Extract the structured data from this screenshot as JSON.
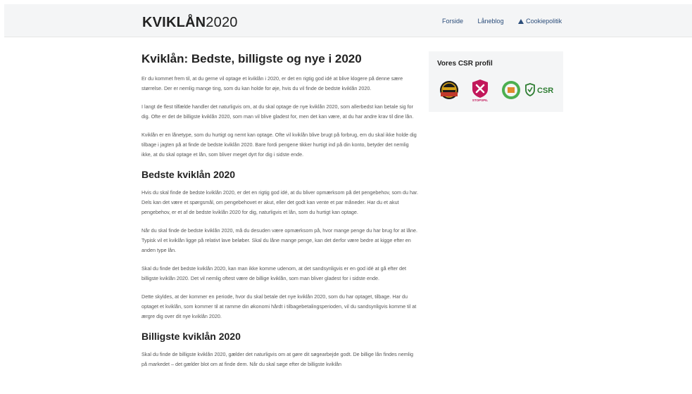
{
  "header": {
    "logo_bold": "KVIKLÅN",
    "logo_year": "2020",
    "nav": [
      {
        "label": "Forside"
      },
      {
        "label": "Låneblog"
      },
      {
        "label": "Cookiepolitik",
        "icon": "warning-icon"
      }
    ]
  },
  "main": {
    "title": "Kviklån: Bedste, billigste og nye i 2020",
    "intro": [
      "Er du kommet frem til, at du gerne vil optage et kviklån i 2020, er det en rigtig god idé at blive klogere på denne sære størrelse. Der er nemlig mange ting, som du kan holde for øje, hvis du vil finde de bedste kviklån 2020.",
      "I langt de flest tilfælde handler det naturligvis om, at du skal optage de nye kviklån 2020, som allerbedst kan betale sig for dig. Ofte er det de billigste kviklån 2020, som man vil blive gladest for, men det kan være, at du har andre krav til dine lån.",
      "Kviklån er en lånetype, som du hurtigt og nemt kan optage. Ofte vil kviklån blive brugt på forbrug, em du skal ikke holde dig tilbage i jagten på at finde de bedste kviklån 2020. Bare fordi pengene tikker hurtigt ind på din konto, betyder det nemlig ikke, at du skal optage et lån, som bliver meget dyrt for dig i sidste ende."
    ],
    "section1": {
      "heading": "Bedste kviklån 2020",
      "paragraphs": [
        "Hvis du skal finde de bedste kviklån 2020, er det en rigtig god idé, at du bliver opmærksom på det pengebehov, som du har. Dels kan det være et spørgsmål, om pengebehovet er akut, eller det godt kan vente et par måneder. Har du et akut pengebehov, er et af de bedste kviklån 2020 for dig, naturligvis et lån, som du hurtigt kan optage.",
        "Når du skal finde de bedste kviklån 2020, må du desuden være opmærksom på, hvor mange penge du har brug for at låne. Typisk vil et kviklån ligge på relativt lave beløber. Skal du låne mange penge, kan det derfor være bedre at kigge efter en anden type lån.",
        "Skal du finde det bedste kviklån 2020, kan man ikke komme udenom, at det sandsynligvis er en god idé at gå efter det billigste kviklån 2020. Det vil nemlig oftest være de billige kviklån, som man bliver gladest for i sidste ende.",
        "Dette skyldes, at der kommer en periode, hvor du skal betale det nye kviklån 2020, som du har optaget, tilbage. Har du optaget et kviklån, som kommer til at ramme din økonomi hårdt i tilbagebetalingsperioden, vil du sandsynligvis komme til at ærgre dig over dit nye kviklån 2020."
      ]
    },
    "section2": {
      "heading": "Billigste kviklån 2020",
      "paragraphs": [
        "Skal du finde de billigste kviklån 2020, gælder det naturligvis om at gøre dit søgearbejde godt. De billige lån findes nemlig på markedet – det gælder blot om at finde dem. Når du skal søge efter de billigste kviklån"
      ]
    }
  },
  "sidebar": {
    "title": "Vores CSR profil",
    "badges": [
      {
        "icon": "casino-badge-icon"
      },
      {
        "icon": "stopspillet-icon",
        "text": "STOPSPIL"
      },
      {
        "icon": "green-circle-badge-icon"
      },
      {
        "icon": "csr-shield-icon",
        "text": "CSR"
      }
    ]
  },
  "colors": {
    "header_bg": "#f4f5f6",
    "nav_link": "#2b4d7a",
    "sidebar_bg": "#f4f5f6"
  }
}
